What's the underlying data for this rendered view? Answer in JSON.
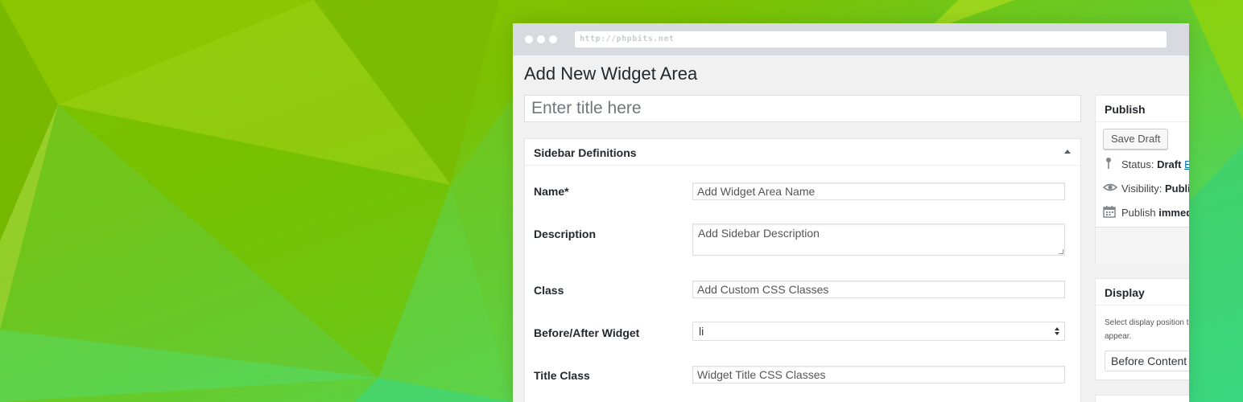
{
  "browser": {
    "url": "http://phpbits.net"
  },
  "page": {
    "title": "Add New Widget Area",
    "title_placeholder": "Enter title here"
  },
  "sidebar_definitions": {
    "heading": "Sidebar Definitions",
    "fields": {
      "name": {
        "label": "Name*",
        "placeholder": "Add Widget Area Name"
      },
      "description": {
        "label": "Description",
        "placeholder": "Add Sidebar Description"
      },
      "class": {
        "label": "Class",
        "placeholder": "Add Custom CSS Classes"
      },
      "before_after": {
        "label": "Before/After Widget",
        "value": "li"
      },
      "title_class": {
        "label": "Title Class",
        "placeholder": "Widget Title CSS Classes"
      }
    }
  },
  "publish": {
    "heading": "Publish",
    "save_draft": "Save Draft",
    "status_label": "Status:",
    "status_value": "Draft",
    "status_edit": "Ed",
    "visibility_label": "Visibility:",
    "visibility_value": "Publi",
    "publish_label": "Publish",
    "publish_value": "immedi"
  },
  "display": {
    "heading": "Display",
    "hint": "Select display position to appear.",
    "position_value": "Before Content"
  },
  "icons": {
    "status": "pin-icon",
    "visibility": "eye-icon",
    "schedule": "calendar-icon"
  },
  "colors": {
    "link": "#0073aa",
    "text": "#23282d",
    "background_green": "#7cc000",
    "background_mint": "#3fdc8a"
  }
}
